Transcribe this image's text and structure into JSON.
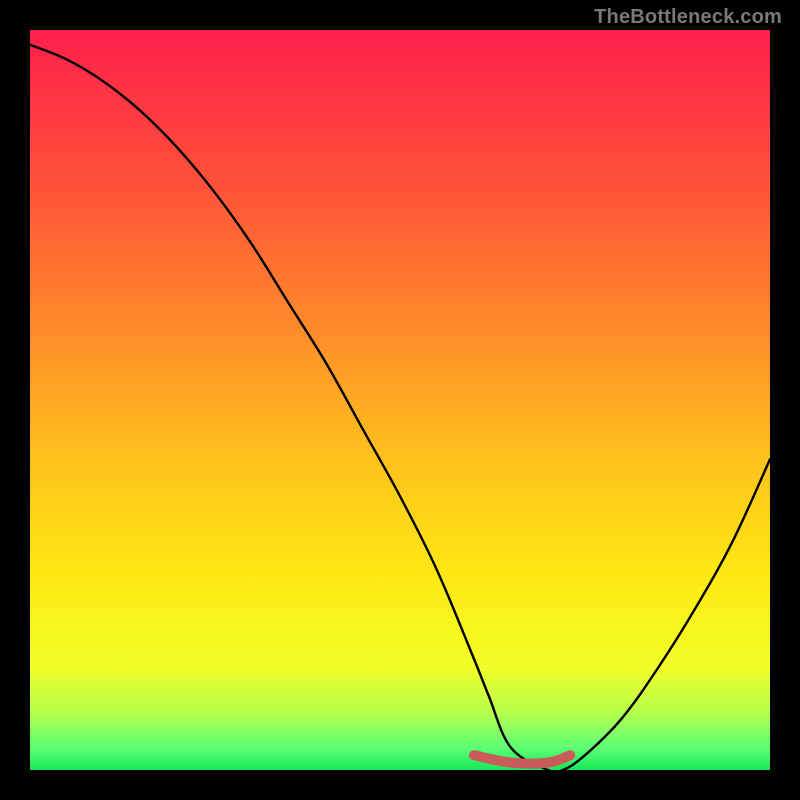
{
  "watermark": "TheBottleneck.com",
  "chart_data": {
    "type": "line",
    "title": "",
    "xlabel": "",
    "ylabel": "",
    "xlim": [
      0,
      100
    ],
    "ylim": [
      0,
      100
    ],
    "grid": false,
    "legend": false,
    "series": [
      {
        "name": "bottleneck-curve",
        "x": [
          0,
          5,
          10,
          15,
          20,
          25,
          30,
          35,
          40,
          45,
          50,
          55,
          60,
          62,
          65,
          70,
          72,
          75,
          80,
          85,
          90,
          95,
          100
        ],
        "values": [
          98,
          96,
          93,
          89,
          84,
          78,
          71,
          63,
          55,
          46,
          37,
          27,
          15,
          10,
          3,
          0,
          0,
          2,
          7,
          14,
          22,
          31,
          42
        ]
      },
      {
        "name": "optimal-range-marker",
        "x": [
          60,
          65,
          70,
          73
        ],
        "values": [
          2,
          1,
          1,
          2
        ]
      }
    ],
    "gradient_stops": [
      {
        "offset": 0.0,
        "color": "#ff1f4b"
      },
      {
        "offset": 0.2,
        "color": "#ff4f3a"
      },
      {
        "offset": 0.4,
        "color": "#ff8a2a"
      },
      {
        "offset": 0.58,
        "color": "#ffc21c"
      },
      {
        "offset": 0.74,
        "color": "#ffe914"
      },
      {
        "offset": 0.86,
        "color": "#f2ff28"
      },
      {
        "offset": 0.92,
        "color": "#b9ff4a"
      },
      {
        "offset": 0.97,
        "color": "#5dff74"
      },
      {
        "offset": 1.0,
        "color": "#18e858"
      }
    ],
    "colors": {
      "curve": "#000000",
      "marker": "#c95b5b",
      "background": "#000000"
    },
    "annotations": []
  }
}
